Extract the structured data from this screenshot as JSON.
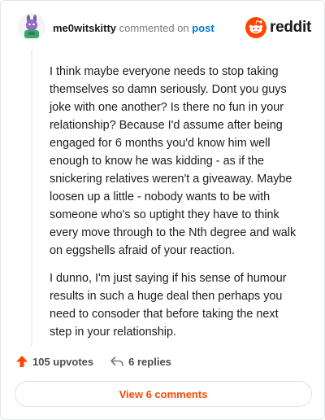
{
  "header": {
    "username": "me0witskitty",
    "action": "commented on",
    "target": "post",
    "brand": "reddit"
  },
  "comment": {
    "paragraphs": [
      "I think maybe everyone needs to stop taking themselves so damn seriously. Dont you guys joke with one another? Is there no fun in your relationship? Because I'd assume after being engaged for 6 months you'd know him well enough to know he was kidding - as if the snickering relatives weren't a giveaway. Maybe loosen up a little - nobody wants to be with someone who's so uptight they have to think every move through to the Nth degree and walk on eggshells afraid of your reaction.",
      "I dunno, I'm just saying if his sense of humour results in such a huge deal then perhaps you need to consoder that before taking the next step in your relationship."
    ]
  },
  "actions": {
    "upvotes_label": "105 upvotes",
    "replies_label": "6 replies"
  },
  "footer": {
    "view_comments_label": "View 6 comments"
  },
  "colors": {
    "accent": "#ff4500",
    "link": "#0079d3",
    "muted": "#787c7e"
  }
}
